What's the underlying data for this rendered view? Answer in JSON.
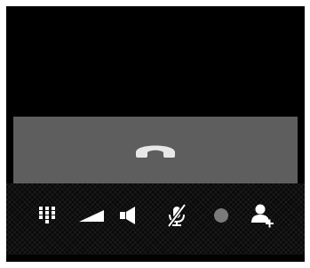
{
  "colors": {
    "window_bg": "#000000",
    "hangup_bar_bg": "#5e5e5e",
    "icon_color": "#ffffff",
    "handset_color": "#e8e8e8",
    "record_dot_color": "#7a7a7a",
    "toolbar_bg": "#0a0a0a"
  },
  "hangup": {
    "icon": "phone-hangup-icon"
  },
  "toolbar": {
    "items": [
      {
        "icon": "dialpad-icon"
      },
      {
        "icon": "volume-level-icon"
      },
      {
        "icon": "speaker-icon"
      },
      {
        "icon": "microphone-muted-icon"
      },
      {
        "icon": "record-dot-icon"
      },
      {
        "icon": "add-contact-icon"
      }
    ]
  }
}
